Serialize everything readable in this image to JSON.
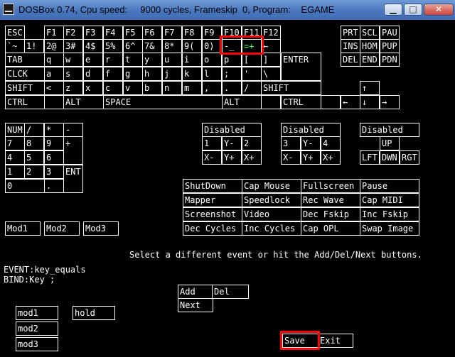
{
  "window": {
    "title": "DOSBox 0.74, Cpu speed:     9000 cycles, Frameskip  0, Program:    EGAME",
    "min_label": "▁",
    "max_label": "□",
    "close_label": "✕"
  },
  "keyboard": {
    "fn_row": [
      "ESC",
      "F1",
      "F2",
      "F3",
      "F4",
      "F5",
      "F6",
      "F7",
      "F8",
      "F9",
      "F10",
      "F11",
      "F12"
    ],
    "num_row": [
      "`~",
      "1!",
      "2@",
      "3#",
      "4$",
      "5%",
      "6^",
      "7&",
      "8*",
      "9(",
      "0)",
      "-_",
      "=+",
      "←"
    ],
    "q_row": [
      "TAB",
      "q",
      "w",
      "e",
      "r",
      "t",
      "y",
      "u",
      "i",
      "o",
      "p",
      "[",
      "]",
      "ENTER"
    ],
    "a_row": [
      "CLCK",
      "a",
      "s",
      "d",
      "f",
      "g",
      "h",
      "j",
      "k",
      "l",
      ";",
      "'",
      "\\"
    ],
    "z_row": [
      "SHIFT",
      "<",
      "z",
      "x",
      "c",
      "v",
      "b",
      "n",
      "m",
      ",",
      ".",
      "/",
      "SHIFT"
    ],
    "ctrl_row": [
      "CTRL",
      "",
      "ALT",
      "SPACE",
      "ALT",
      "",
      "CTRL",
      ""
    ],
    "nav_top": [
      "PRT",
      "SCL",
      "PAU"
    ],
    "nav_mid": [
      "INS",
      "HOM",
      "PUP"
    ],
    "nav_bot": [
      "DEL",
      "END",
      "PDN"
    ],
    "arrows": {
      "up": "↑",
      "left": "←",
      "down": "↓",
      "right": "→"
    }
  },
  "numpad": {
    "row1": [
      "NUM",
      "/",
      "*",
      "-"
    ],
    "row2": [
      "7",
      "8",
      "9",
      "+"
    ],
    "row3": [
      "4",
      "5",
      "6"
    ],
    "row4": [
      "1",
      "2",
      "3",
      "ENT"
    ],
    "row5": [
      "0",
      "."
    ]
  },
  "joysticks": {
    "status": [
      "Disabled",
      "Disabled",
      "Disabled"
    ],
    "axis1": [
      "1",
      "Y-",
      "2",
      "X-",
      "Y+",
      "X+"
    ],
    "axis2": [
      "3",
      "Y-",
      "4",
      "X-",
      "Y+",
      "X+"
    ],
    "hat": [
      "UP",
      "LFT",
      "DWN",
      "RGT"
    ]
  },
  "special": [
    [
      "ShutDown",
      "Cap Mouse",
      "Fullscreen",
      "Pause"
    ],
    [
      "Mapper",
      "Speedlock",
      "Rec Wave",
      "Cap MIDI"
    ],
    [
      "Screenshot",
      "Video",
      "Dec Fskip",
      "Inc Fskip"
    ],
    [
      "Dec Cycles",
      "Inc Cycles",
      "Cap OPL",
      "Swap Image"
    ]
  ],
  "mods": [
    "Mod1",
    "Mod2",
    "Mod3"
  ],
  "message": "Select a different event or hit the Add/Del/Next buttons.",
  "event_line": "EVENT:key_equals",
  "bind_line": "BIND:Key ;",
  "actions": {
    "add": "Add",
    "del": "Del",
    "next": "Next",
    "save": "Save",
    "exit": "Exit"
  },
  "bind_mods": {
    "mod1": "mod1",
    "mod2": "mod2",
    "mod3": "mod3",
    "hold": "hold"
  },
  "colors": {
    "highlight": "#55ff55",
    "annotation": "#ff0000"
  }
}
